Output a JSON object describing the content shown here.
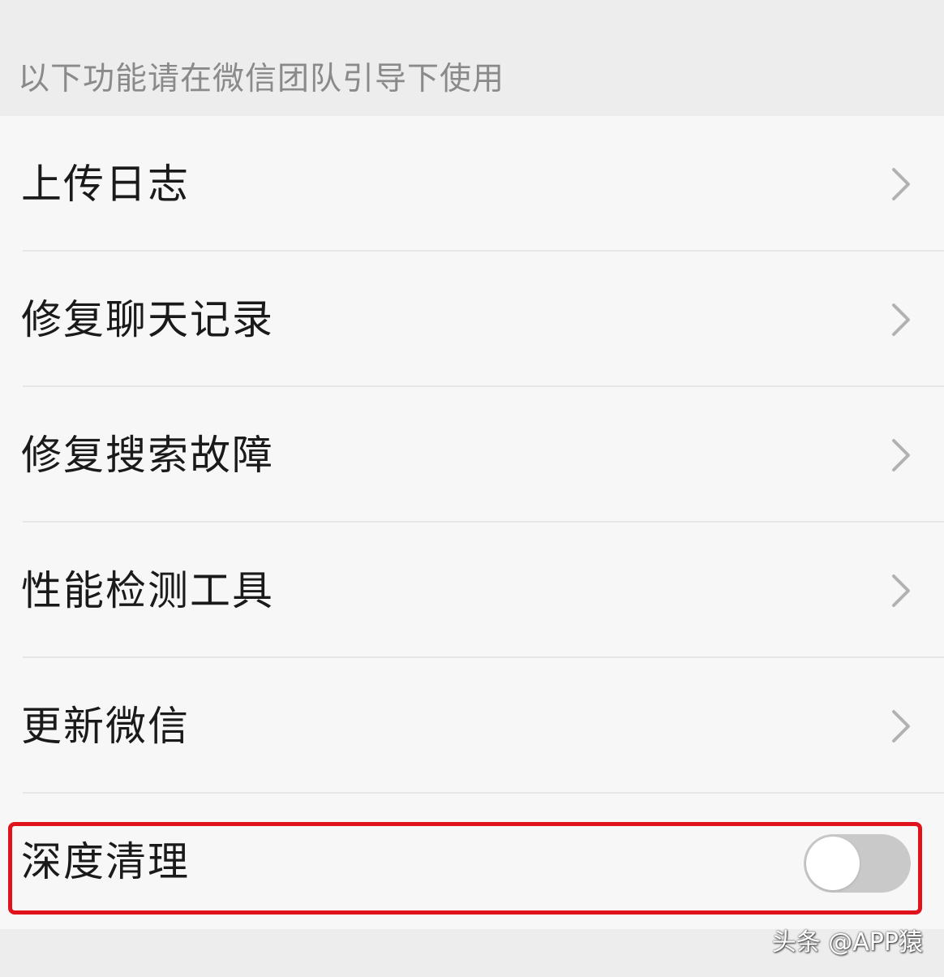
{
  "section_header": "以下功能请在微信团队引导下使用",
  "items": [
    {
      "label": "上传日志",
      "control": "chevron-right-icon"
    },
    {
      "label": "修复聊天记录",
      "control": "chevron-right-icon"
    },
    {
      "label": "修复搜索故障",
      "control": "chevron-right-icon"
    },
    {
      "label": "性能检测工具",
      "control": "chevron-right-icon"
    },
    {
      "label": "更新微信",
      "control": "chevron-right-icon"
    }
  ],
  "toggle_item": {
    "label": "深度清理",
    "enabled": false
  },
  "highlight_color": "#e0121c",
  "watermark": "头条 @APP猿"
}
